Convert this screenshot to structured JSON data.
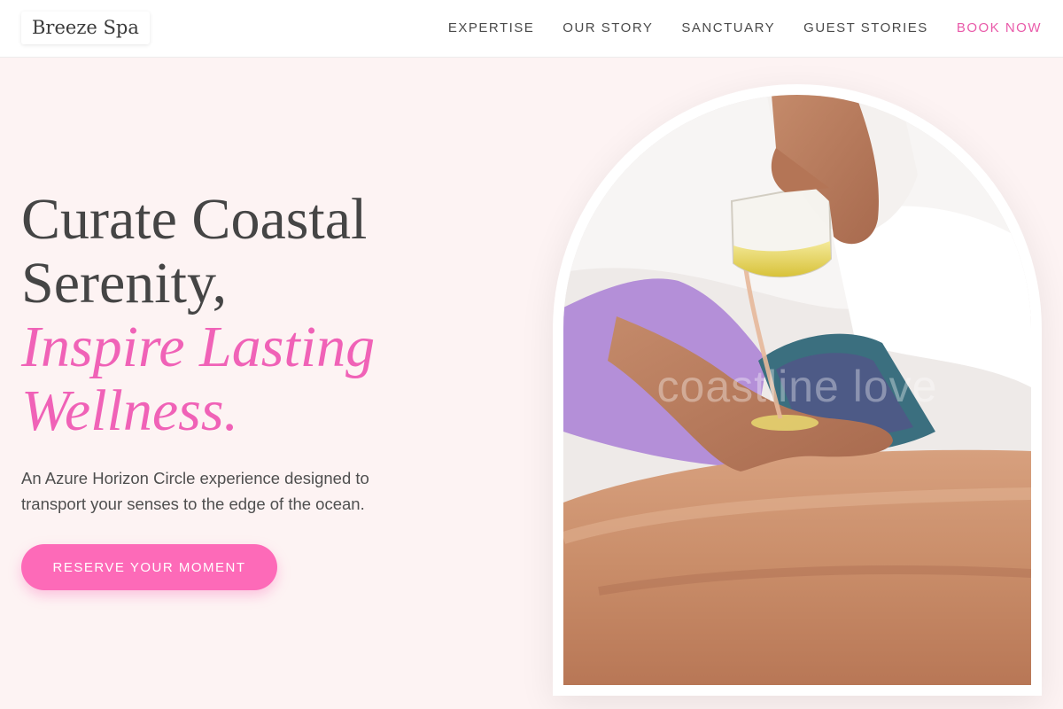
{
  "header": {
    "logo_text": "Breeze Spa",
    "nav": [
      {
        "label": "EXPERTISE"
      },
      {
        "label": "OUR STORY"
      },
      {
        "label": "SANCTUARY"
      },
      {
        "label": "GUEST STORIES"
      },
      {
        "label": "BOOK NOW"
      }
    ]
  },
  "hero": {
    "title_lines": [
      "Curate Coastal",
      "Serenity,"
    ],
    "title_accent_lines": [
      "Inspire Lasting",
      "Wellness."
    ],
    "subtitle_lines": [
      "An Azure Horizon Circle experience designed to",
      "transport your senses to the edge of the ocean."
    ],
    "cta_label": "RESERVE YOUR MOMENT",
    "image": {
      "subject": "massage-oil-pouring-photo",
      "watermark": "coastline love"
    }
  },
  "colors": {
    "accent_pink": "#f062b7",
    "button_pink": "#fd6ab8",
    "page_background": "#fdf3f3",
    "header_background": "#ffffff",
    "text_dark": "#454545"
  }
}
